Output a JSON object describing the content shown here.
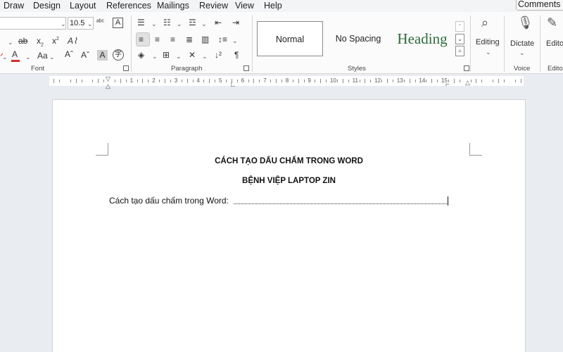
{
  "menu": {
    "items": [
      "Draw",
      "Design",
      "Layout",
      "References",
      "Mailings",
      "Review",
      "View",
      "Help"
    ],
    "comments_label": "Comments"
  },
  "font_group": {
    "label": "Font",
    "font_size": "10.5"
  },
  "paragraph_group": {
    "label": "Paragraph"
  },
  "styles_group": {
    "label": "Styles",
    "normal": "Normal",
    "no_spacing": "No Spacing",
    "heading": "Heading"
  },
  "editing": {
    "label": "Editing"
  },
  "voice": {
    "label": "Voice",
    "dictate": "Dictate"
  },
  "editor": {
    "label": "Edito"
  },
  "ruler": {
    "numbers": [
      "1",
      "2",
      "3",
      "4",
      "5",
      "6",
      "7",
      "8",
      "9",
      "10",
      "11",
      "12",
      "13",
      "14",
      "15"
    ]
  },
  "document": {
    "title1": "CÁCH TẠO DẤU CHẤM TRONG WORD",
    "title2": "BỆNH VIỆP LAPTOP ZIN",
    "line_label": "Cách tạo dấu chấm trong Word:"
  },
  "colors": {
    "ribbon_bg": "#fbfbfb",
    "canvas_bg": "#e9ecf1",
    "heading_style_green": "#2e6b3a",
    "font_color_red": "#d32f2f"
  }
}
